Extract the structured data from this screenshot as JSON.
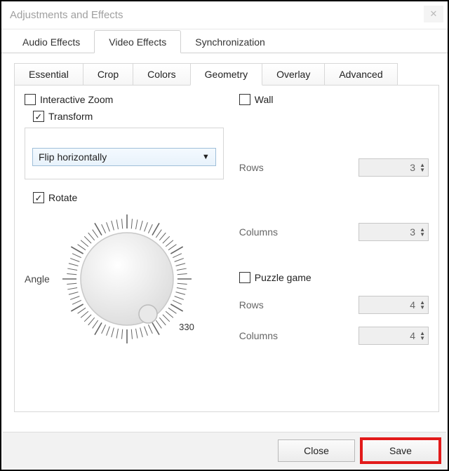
{
  "window": {
    "title": "Adjustments and Effects"
  },
  "top_tabs": {
    "audio": "Audio Effects",
    "video": "Video Effects",
    "sync": "Synchronization",
    "active": "Video Effects"
  },
  "sub_tabs": {
    "essential": "Essential",
    "crop": "Crop",
    "colors": "Colors",
    "geometry": "Geometry",
    "overlay": "Overlay",
    "advanced": "Advanced",
    "active": "Geometry"
  },
  "geometry": {
    "interactive_zoom": {
      "label": "Interactive Zoom",
      "checked": false
    },
    "transform": {
      "label": "Transform",
      "checked": true,
      "selected": "Flip horizontally"
    },
    "rotate": {
      "label": "Rotate",
      "checked": true,
      "angle_label": "Angle",
      "angle_value": 330,
      "tick_label": "330"
    },
    "wall": {
      "label": "Wall",
      "checked": false,
      "rows_label": "Rows",
      "rows_value": "3",
      "cols_label": "Columns",
      "cols_value": "3"
    },
    "puzzle": {
      "label": "Puzzle game",
      "checked": false,
      "rows_label": "Rows",
      "rows_value": "4",
      "cols_label": "Columns",
      "cols_value": "4"
    }
  },
  "footer": {
    "close": "Close",
    "save": "Save"
  }
}
